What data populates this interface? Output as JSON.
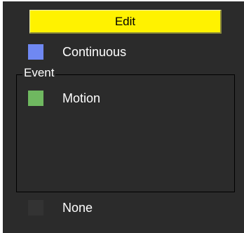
{
  "edit": {
    "label": "Edit"
  },
  "continuous": {
    "label": "Continuous",
    "color": "#6f88f2"
  },
  "event": {
    "title": "Event",
    "motion": {
      "label": "Motion",
      "color": "#6fb860"
    }
  },
  "none": {
    "label": "None",
    "color": "#333333"
  }
}
